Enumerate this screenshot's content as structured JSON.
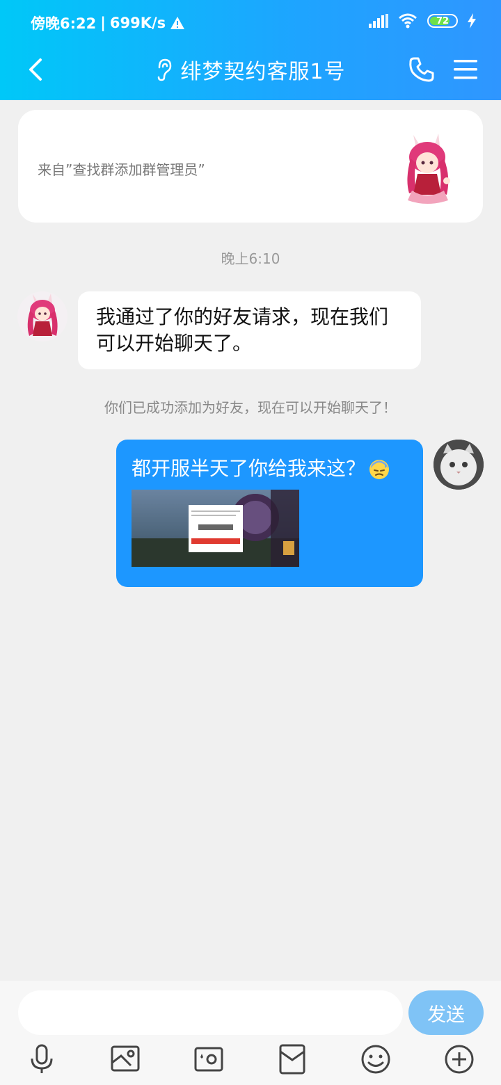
{
  "status_bar": {
    "time": "傍晚6:22",
    "speed": "699K/s",
    "battery": "72"
  },
  "header": {
    "title": "绯梦契约客服1号"
  },
  "source_card": {
    "text": "来自”查找群添加群管理员”"
  },
  "chat": {
    "timestamp": "晚上6:10",
    "incoming_message": "我通过了你的好友请求，现在我们可以开始聊天了。",
    "system_notice": "你们已成功添加为好友，现在可以开始聊天了！",
    "outgoing_message": "都开服半天了你给我来这？"
  },
  "input_bar": {
    "placeholder": "",
    "send_label": "发送"
  },
  "colors": {
    "header_start": "#00c8f8",
    "header_end": "#2f96ff",
    "outgoing_bubble": "#1d97ff",
    "send_button": "#7fc3f6",
    "background": "#f0f0f0"
  },
  "icons": [
    "back-arrow-icon",
    "ear-icon",
    "phone-icon",
    "menu-icon",
    "microphone-icon",
    "image-icon",
    "camera-icon",
    "red-packet-icon",
    "emoji-icon",
    "plus-icon"
  ]
}
